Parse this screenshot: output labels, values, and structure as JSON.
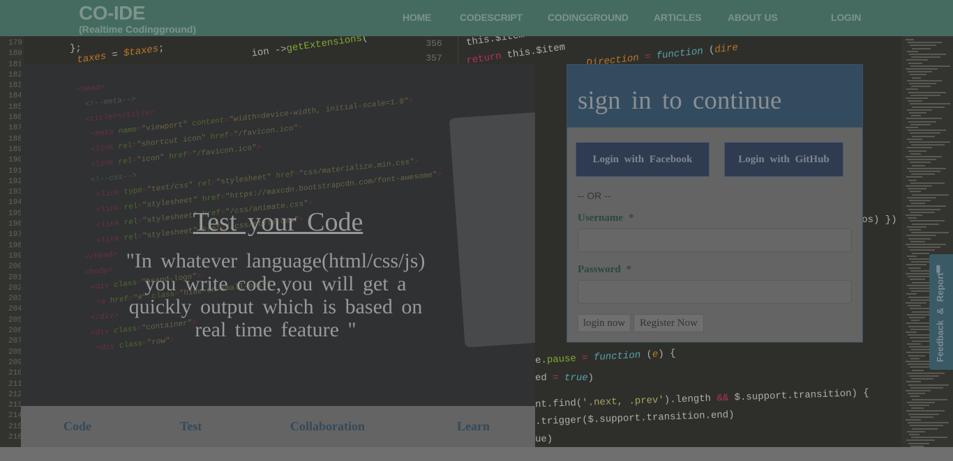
{
  "brand": {
    "title": "CO-IDE",
    "subtitle": "(Realtime Codingground)"
  },
  "nav": {
    "items": [
      "HOME",
      "CODESCRIPT",
      "CODINGGROUND",
      "ARTICLES",
      "ABOUT US"
    ],
    "login": "LOGIN"
  },
  "hero": {
    "title": "Test your Code",
    "quote": "\"In whatever language(html/css/js) you write code,you will get a quickly output which is based on real time feature \""
  },
  "features": [
    "Code",
    "Test",
    "Collaboration",
    "Learn"
  ],
  "signin": {
    "title": "sign in to continue",
    "facebook_label": "Login with Facebook",
    "github_label": "Login with GitHub",
    "or_text": "-- OR --",
    "username_label": "Username",
    "password_label": "Password",
    "required_mark": "*",
    "username_value": "",
    "password_value": "",
    "login_button": "login now",
    "register_button": "Register Now"
  },
  "feedback": {
    "label": "Feedback & Report"
  },
  "editor": {
    "line_numbers": [
      "179",
      "180",
      "181",
      "182",
      "183",
      "184",
      "185",
      "186",
      "187",
      "188",
      "189",
      "190",
      "191",
      "192",
      "193",
      "194",
      "195",
      "196",
      "197",
      "198",
      "199",
      "200",
      "201",
      "202",
      "203",
      "204",
      "205",
      "206",
      "207",
      "208",
      "209",
      "210",
      "211",
      "212",
      "213",
      "214",
      "215",
      "216"
    ],
    "top_numbers": [
      "356",
      "357"
    ]
  },
  "colors": {
    "navbar": "#4b8473",
    "panel_header": "#2f5372",
    "accent": "#31506b"
  }
}
